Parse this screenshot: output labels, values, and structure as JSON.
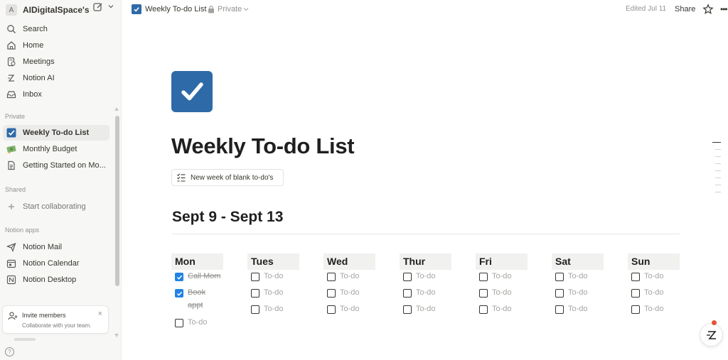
{
  "sidebar": {
    "workspace": {
      "initial": "A",
      "name": "AIDigitalSpace's ..."
    },
    "top_items": [
      {
        "label": "Search",
        "icon": "search-icon"
      },
      {
        "label": "Home",
        "icon": "home-icon"
      },
      {
        "label": "Meetings",
        "icon": "meetings-icon"
      },
      {
        "label": "Notion AI",
        "icon": "notion-ai-icon"
      },
      {
        "label": "Inbox",
        "icon": "inbox-icon"
      }
    ],
    "sections": {
      "private": "Private",
      "shared": "Shared",
      "apps": "Notion apps"
    },
    "private_items": [
      {
        "label": "Weekly To-do List",
        "icon": "checkbox-icon"
      },
      {
        "label": "Monthly Budget",
        "icon": "money-icon"
      },
      {
        "label": "Getting Started on Mo...",
        "icon": "page-icon"
      }
    ],
    "shared_items": [
      {
        "label": "Start collaborating",
        "icon": "plus-icon"
      }
    ],
    "app_items": [
      {
        "label": "Notion Mail",
        "icon": "mail-icon"
      },
      {
        "label": "Notion Calendar",
        "icon": "calendar-icon"
      },
      {
        "label": "Notion Desktop",
        "icon": "desktop-icon"
      }
    ],
    "invite": {
      "title": "Invite members",
      "subtitle": "Collaborate with your team.",
      "close": "×"
    },
    "help": "?"
  },
  "topbar": {
    "title": "Weekly To-do List",
    "privacy": "Private",
    "edited": "Edited Jul 11",
    "share": "Share",
    "more": "•••"
  },
  "page": {
    "title": "Weekly To-do List",
    "template_button": "New week of blank to-do's",
    "week_heading": "Sept 9 - Sept 13",
    "days": [
      {
        "name": "Mon",
        "todos": [
          {
            "text": "Call Mom",
            "checked": true
          },
          {
            "text": "Book appt",
            "checked": true
          },
          {
            "text": "To-do",
            "checked": false
          }
        ]
      },
      {
        "name": "Tues",
        "todos": [
          {
            "text": "To-do",
            "checked": false
          },
          {
            "text": "To-do",
            "checked": false
          },
          {
            "text": "To-do",
            "checked": false
          }
        ]
      },
      {
        "name": "Wed",
        "todos": [
          {
            "text": "To-do",
            "checked": false
          },
          {
            "text": "To-do",
            "checked": false
          },
          {
            "text": "To-do",
            "checked": false
          }
        ]
      },
      {
        "name": "Thur",
        "todos": [
          {
            "text": "To-do",
            "checked": false
          },
          {
            "text": "To-do",
            "checked": false
          },
          {
            "text": "To-do",
            "checked": false
          }
        ]
      },
      {
        "name": "Fri",
        "todos": [
          {
            "text": "To-do",
            "checked": false
          },
          {
            "text": "To-do",
            "checked": false
          },
          {
            "text": "To-do",
            "checked": false
          }
        ]
      },
      {
        "name": "Sat",
        "todos": [
          {
            "text": "To-do",
            "checked": false
          },
          {
            "text": "To-do",
            "checked": false
          },
          {
            "text": "To-do",
            "checked": false
          }
        ]
      },
      {
        "name": "Sun",
        "todos": [
          {
            "text": "To-do",
            "checked": false
          },
          {
            "text": "To-do",
            "checked": false
          },
          {
            "text": "To-do",
            "checked": false
          }
        ]
      }
    ]
  },
  "colors": {
    "accent_blue": "#2383e2",
    "page_icon_blue": "#2e6aa8",
    "sidebar_bg": "#f7f7f5",
    "day_header_bg": "#f1f1ef"
  }
}
